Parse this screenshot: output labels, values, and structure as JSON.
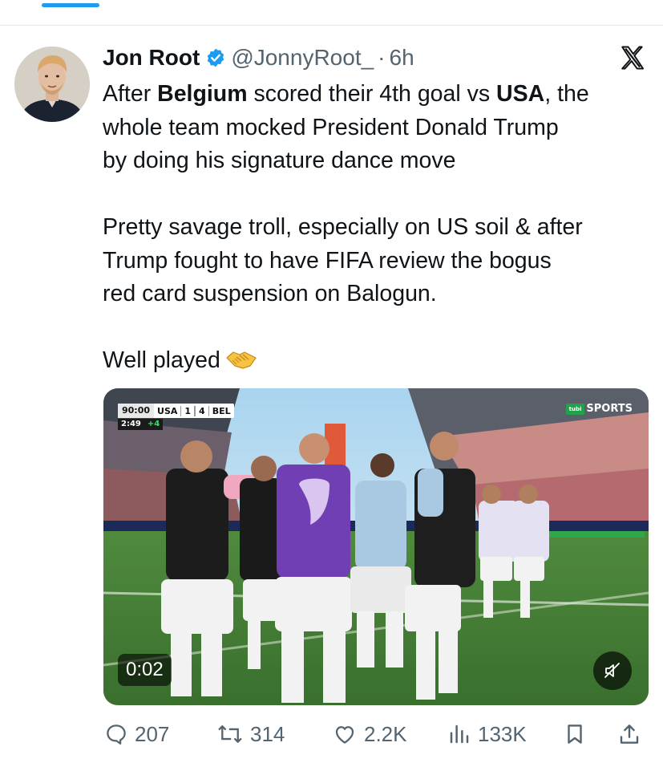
{
  "tweet": {
    "author": {
      "display_name": "Jon Root",
      "handle": "@JonnyRoot_",
      "separator": "·",
      "time": "6h"
    },
    "text": {
      "p1_part1": "After ",
      "p1_bold1": "Belgium",
      "p1_part2": " scored their 4th goal vs ",
      "p1_bold2": "USA",
      "p1_part3": ", the",
      "p1_line2": "whole team mocked President Donald Trump",
      "p1_line3": "by doing his signature dance move",
      "p2_line1": "Pretty savage troll, especially on US soil & after",
      "p2_line2": "Trump fought to have FIFA review the bogus",
      "p2_line3": "red card suspension on Balogun.",
      "p3": "Well played"
    },
    "media": {
      "scorebug": {
        "clock": "90:00",
        "home": "USA",
        "home_score": "1",
        "away_score": "4",
        "away": "BEL",
        "added_clock": "2:49",
        "added_time": "+4"
      },
      "broadcaster": "SPORTS",
      "broadcaster_badge": "tubi",
      "timestamp": "0:02"
    },
    "actions": {
      "replies": "207",
      "reposts": "314",
      "likes": "2.2K",
      "views": "133K"
    }
  },
  "colors": {
    "accent": "#1d9bf0",
    "text": "#0f1419",
    "secondary": "#536471"
  },
  "icons": [
    "verified-badge-icon",
    "x-logo-icon",
    "handshake-emoji-icon",
    "mute-icon",
    "reply-icon",
    "repost-icon",
    "like-icon",
    "views-icon",
    "bookmark-icon",
    "share-icon"
  ]
}
